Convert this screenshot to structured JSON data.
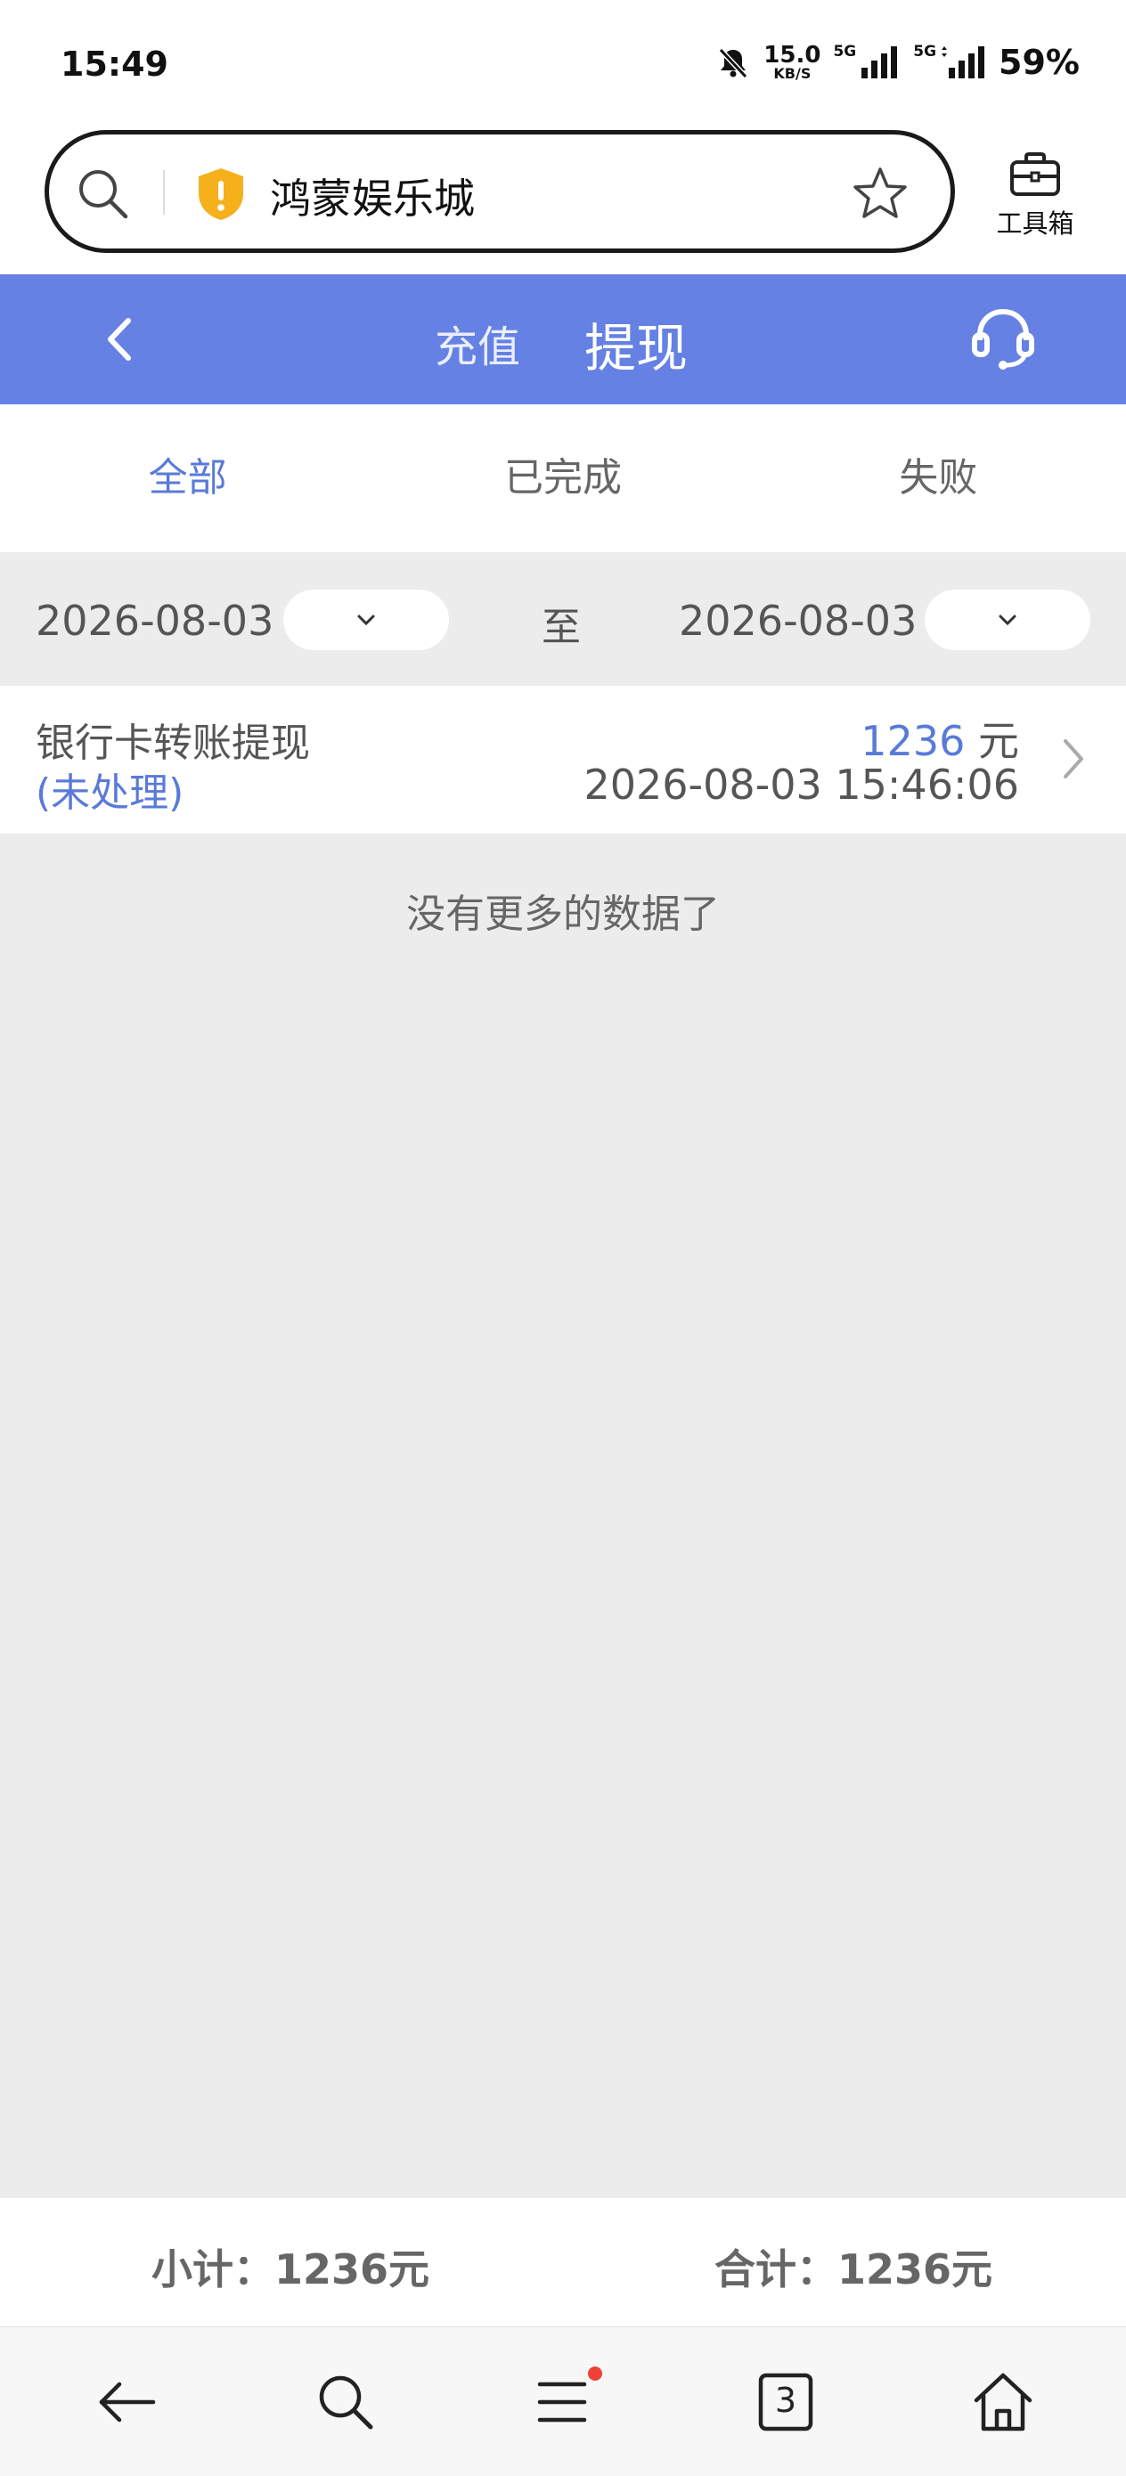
{
  "status_bar": {
    "time": "15:49",
    "net_speed_value": "15.0",
    "net_speed_unit": "KB/S",
    "signal_label_1": "5G",
    "signal_label_2": "5G",
    "battery": "59%"
  },
  "browser": {
    "site_title": "鸿蒙娱乐城",
    "toolbox_label": "工具箱",
    "icons": [
      "search-icon",
      "shield-warning-icon",
      "star-icon",
      "toolbox-icon"
    ]
  },
  "header": {
    "tab_recharge": "充值",
    "tab_withdraw": "提现",
    "background_color": "#6581e3"
  },
  "filters": {
    "tabs": [
      {
        "label": "全部",
        "active": true
      },
      {
        "label": "已完成",
        "active": false
      },
      {
        "label": "失败",
        "active": false
      }
    ],
    "active_color": "#5a7ad8"
  },
  "date_range": {
    "start": "2026-08-03",
    "separator": "至",
    "end": "2026-08-03"
  },
  "records": [
    {
      "type": "银行卡转账提现",
      "status": "(未处理)",
      "amount": "1236",
      "unit": "元",
      "time": "2026-08-03 15:46:06"
    }
  ],
  "no_more_text": "没有更多的数据了",
  "totals": {
    "subtotal_label": "小计：",
    "subtotal_value": "1236元",
    "total_label": "合计：",
    "total_value": "1236元"
  },
  "bottom_nav": {
    "tab_count": "3",
    "items": [
      "back-icon",
      "search-icon",
      "menu-icon",
      "tabs-icon",
      "home-icon"
    ]
  }
}
